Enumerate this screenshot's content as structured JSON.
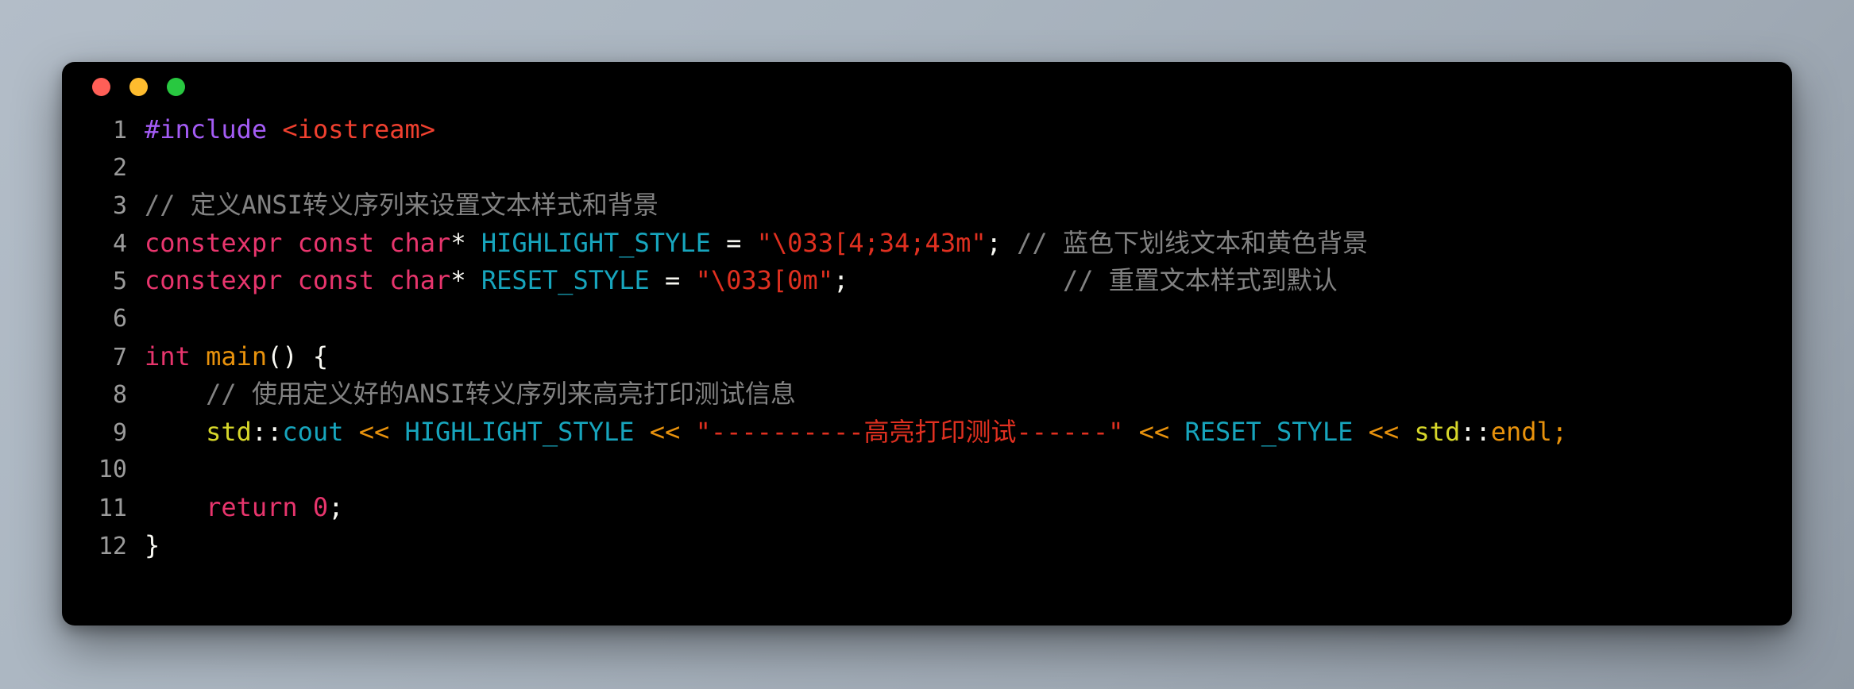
{
  "window": {
    "background_color": "#000000",
    "desktop_color": "#aab5c0",
    "buttons": [
      {
        "name": "close",
        "color": "#ff5f57"
      },
      {
        "name": "minimize",
        "color": "#febc2e"
      },
      {
        "name": "zoom",
        "color": "#28c840"
      }
    ]
  },
  "editor": {
    "language": "C++",
    "line_numbers": [
      "1",
      "2",
      "3",
      "4",
      "5",
      "6",
      "7",
      "8",
      "9",
      "10",
      "11",
      "12"
    ],
    "lines": [
      {
        "number": "1",
        "text": "#include <iostream>",
        "tokens": [
          {
            "t": "#include",
            "c": "t-pre"
          },
          {
            "t": " ",
            "c": "t-op"
          },
          {
            "t": "<iostream>",
            "c": "t-header"
          }
        ]
      },
      {
        "number": "2",
        "text": "",
        "tokens": []
      },
      {
        "number": "3",
        "text": "// 定义ANSI转义序列来设置文本样式和背景",
        "tokens": [
          {
            "t": "// 定义ANSI转义序列来设置文本样式和背景",
            "c": "t-comment"
          }
        ]
      },
      {
        "number": "4",
        "text": "constexpr const char* HIGHLIGHT_STYLE = \"\\033[4;34;43m\"; // 蓝色下划线文本和黄色背景",
        "tokens": [
          {
            "t": "constexpr",
            "c": "t-kw"
          },
          {
            "t": " ",
            "c": "t-op"
          },
          {
            "t": "const",
            "c": "t-kw"
          },
          {
            "t": " ",
            "c": "t-op"
          },
          {
            "t": "char",
            "c": "t-kw"
          },
          {
            "t": "* ",
            "c": "t-op"
          },
          {
            "t": "HIGHLIGHT_STYLE",
            "c": "t-var"
          },
          {
            "t": " = ",
            "c": "t-op"
          },
          {
            "t": "\"\\033[4;34;43m\"",
            "c": "t-str"
          },
          {
            "t": "; ",
            "c": "t-op"
          },
          {
            "t": "// 蓝色下划线文本和黄色背景",
            "c": "t-comment"
          }
        ]
      },
      {
        "number": "5",
        "text": "constexpr const char* RESET_STYLE = \"\\033[0m\";            // 重置文本样式到默认",
        "tokens": [
          {
            "t": "constexpr",
            "c": "t-kw"
          },
          {
            "t": " ",
            "c": "t-op"
          },
          {
            "t": "const",
            "c": "t-kw"
          },
          {
            "t": " ",
            "c": "t-op"
          },
          {
            "t": "char",
            "c": "t-kw"
          },
          {
            "t": "* ",
            "c": "t-op"
          },
          {
            "t": "RESET_STYLE",
            "c": "t-var"
          },
          {
            "t": " = ",
            "c": "t-op"
          },
          {
            "t": "\"\\033[0m\"",
            "c": "t-str"
          },
          {
            "t": ";              ",
            "c": "t-op"
          },
          {
            "t": "// 重置文本样式到默认",
            "c": "t-comment"
          }
        ]
      },
      {
        "number": "6",
        "text": "",
        "tokens": []
      },
      {
        "number": "7",
        "text": "int main() {",
        "tokens": [
          {
            "t": "int",
            "c": "t-kw"
          },
          {
            "t": " ",
            "c": "t-op"
          },
          {
            "t": "main",
            "c": "t-fn"
          },
          {
            "t": "() {",
            "c": "t-op"
          }
        ]
      },
      {
        "number": "8",
        "text": "    // 使用定义好的ANSI转义序列来高亮打印测试信息",
        "tokens": [
          {
            "t": "    ",
            "c": "t-op"
          },
          {
            "t": "// 使用定义好的ANSI转义序列来高亮打印测试信息",
            "c": "t-comment"
          }
        ]
      },
      {
        "number": "9",
        "text": "    std::cout << HIGHLIGHT_STYLE << \"----------高亮打印测试------\" << RESET_STYLE << std::endl;",
        "tokens": [
          {
            "t": "    ",
            "c": "t-op"
          },
          {
            "t": "std",
            "c": "t-ns"
          },
          {
            "t": "::",
            "c": "t-op"
          },
          {
            "t": "cout",
            "c": "t-member"
          },
          {
            "t": " ",
            "c": "t-op"
          },
          {
            "t": "<<",
            "c": "t-shift"
          },
          {
            "t": " ",
            "c": "t-op"
          },
          {
            "t": "HIGHLIGHT_STYLE",
            "c": "t-var"
          },
          {
            "t": " ",
            "c": "t-op"
          },
          {
            "t": "<<",
            "c": "t-shift"
          },
          {
            "t": " ",
            "c": "t-op"
          },
          {
            "t": "\"----------高亮打印测试------\"",
            "c": "t-str"
          },
          {
            "t": " ",
            "c": "t-op"
          },
          {
            "t": "<<",
            "c": "t-shift"
          },
          {
            "t": " ",
            "c": "t-op"
          },
          {
            "t": "RESET_STYLE",
            "c": "t-var"
          },
          {
            "t": " ",
            "c": "t-op"
          },
          {
            "t": "<<",
            "c": "t-shift"
          },
          {
            "t": " ",
            "c": "t-op"
          },
          {
            "t": "std",
            "c": "t-ns"
          },
          {
            "t": "::",
            "c": "t-op"
          },
          {
            "t": "endl",
            "c": "t-endl"
          },
          {
            "t": ";",
            "c": "t-endl"
          }
        ]
      },
      {
        "number": "10",
        "text": "",
        "tokens": []
      },
      {
        "number": "11",
        "text": "    return 0;",
        "tokens": [
          {
            "t": "    ",
            "c": "t-op"
          },
          {
            "t": "return",
            "c": "t-kw"
          },
          {
            "t": " ",
            "c": "t-op"
          },
          {
            "t": "0",
            "c": "t-num"
          },
          {
            "t": ";",
            "c": "t-op"
          }
        ]
      },
      {
        "number": "12",
        "text": "}",
        "tokens": [
          {
            "t": "}",
            "c": "t-op"
          }
        ]
      }
    ]
  }
}
